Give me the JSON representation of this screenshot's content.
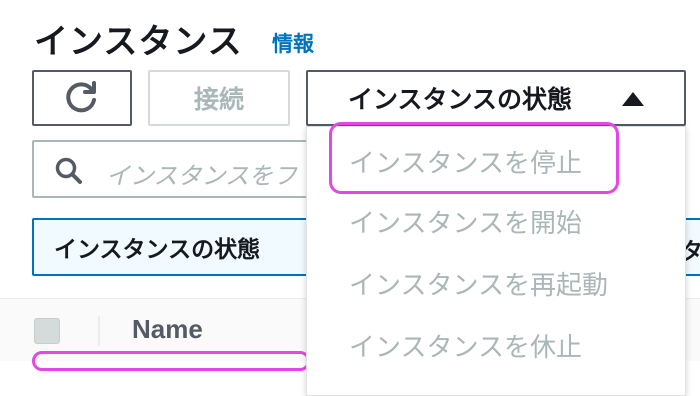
{
  "header": {
    "title": "インスタンス",
    "info_link": "情報"
  },
  "toolbar": {
    "refresh_icon": "refresh-icon",
    "connect_label": "接続",
    "state_label": "インスタンスの状態",
    "state_caret_icon": "caret-up-icon"
  },
  "search": {
    "icon": "search-icon",
    "placeholder": "インスタンスをフ"
  },
  "filter": {
    "token_label": "インスタンスの状態",
    "right_token_label": "タ"
  },
  "table": {
    "columns": [
      "Name"
    ]
  },
  "dropdown": {
    "items": [
      {
        "label": "インスタンスを停止"
      },
      {
        "label": "インスタンスを開始"
      },
      {
        "label": "インスタンスを再起動"
      },
      {
        "label": "インスタンスを休止"
      }
    ]
  },
  "colors": {
    "link": "#0073bb",
    "highlight": "#e546e6",
    "disabled_text": "#aab7b8",
    "filter_border": "#0073bb"
  }
}
